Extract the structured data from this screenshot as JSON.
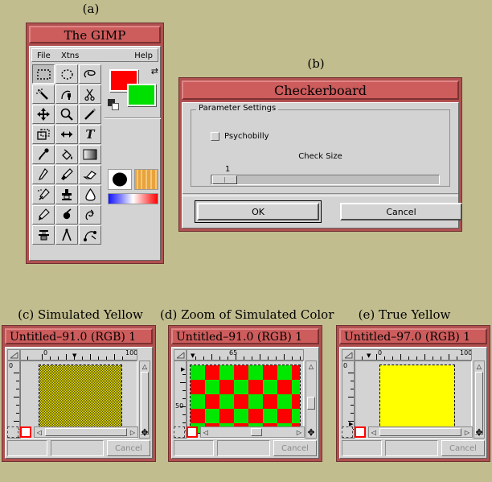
{
  "figure": {
    "labels": {
      "a": "(a)",
      "b": "(b)",
      "c": "(c) Simulated Yellow",
      "d": "(d) Zoom of Simulated Color",
      "e": "(e) True Yellow"
    },
    "background_color": "#c2bd8f"
  },
  "colors": {
    "titlebar": "#cd5c5c",
    "window_frame": "#b05050",
    "panel": "#d3d3d3",
    "foreground_swatch": "#ff0000",
    "background_swatch": "#00e000",
    "checker_red": "#ff0000",
    "checker_green": "#00e800",
    "true_yellow": "#ffff00",
    "simulated_yellow": "#8a8a10",
    "quickmask_active": "#ff0000"
  },
  "toolbox": {
    "title": "The GIMP",
    "menu": [
      {
        "label": "File"
      },
      {
        "label": "Xtns"
      },
      {
        "label": "Help"
      }
    ],
    "tools": [
      {
        "name": "rect-select-tool",
        "glyph": "rect-select",
        "active": true
      },
      {
        "name": "ellipse-select-tool",
        "glyph": "ellipse-select",
        "active": false
      },
      {
        "name": "free-select-tool",
        "glyph": "lasso",
        "active": false
      },
      {
        "name": "fuzzy-select-tool",
        "glyph": "magic-wand",
        "active": false
      },
      {
        "name": "bezier-select-tool",
        "glyph": "bezier-pen",
        "active": false
      },
      {
        "name": "intelligent-scissors-tool",
        "glyph": "scissors",
        "active": false
      },
      {
        "name": "move-tool",
        "glyph": "move-arrows",
        "active": false
      },
      {
        "name": "magnify-tool",
        "glyph": "magnifier",
        "active": false
      },
      {
        "name": "measure-tool",
        "glyph": "ruler-line",
        "active": false
      },
      {
        "name": "crop-tool",
        "glyph": "crop",
        "active": false
      },
      {
        "name": "transform-tool",
        "glyph": "flip-arrows",
        "active": false
      },
      {
        "name": "text-tool",
        "glyph": "letter-T",
        "active": false
      },
      {
        "name": "color-picker-tool",
        "glyph": "eyedropper",
        "active": false
      },
      {
        "name": "bucket-fill-tool",
        "glyph": "paint-bucket",
        "active": false
      },
      {
        "name": "blend-tool",
        "glyph": "gradient",
        "active": false
      },
      {
        "name": "pencil-tool",
        "glyph": "pencil",
        "active": false
      },
      {
        "name": "paintbrush-tool",
        "glyph": "paintbrush",
        "active": false
      },
      {
        "name": "eraser-tool",
        "glyph": "eraser",
        "active": false
      },
      {
        "name": "airbrush-tool",
        "glyph": "airbrush",
        "active": false
      },
      {
        "name": "clone-tool",
        "glyph": "stamp",
        "active": false
      },
      {
        "name": "convolve-tool",
        "glyph": "water-drop",
        "active": false
      },
      {
        "name": "ink-tool",
        "glyph": "ink-pen",
        "active": false
      },
      {
        "name": "dodge-burn-tool",
        "glyph": "dodge-burn",
        "active": false
      },
      {
        "name": "smudge-tool",
        "glyph": "smudge-hand",
        "active": false
      },
      {
        "name": "script-fu-tool",
        "glyph": "script-fu",
        "active": false
      },
      {
        "name": "path-tool",
        "glyph": "compass",
        "active": false
      },
      {
        "name": "curve-tool",
        "glyph": "curve-nodes",
        "active": false
      }
    ],
    "indicators": {
      "swap_icon": "⇄",
      "brush": "brush-indicator",
      "pattern": "pattern-indicator",
      "gradient": "gradient-indicator"
    }
  },
  "checkerboard_dialog": {
    "title": "Checkerboard",
    "frame_legend": "Parameter Settings",
    "psychobilly": {
      "label": "Psychobilly",
      "checked": false
    },
    "check_size": {
      "label": "Check Size",
      "value": "1"
    },
    "buttons": {
      "ok": "OK",
      "cancel": "Cancel"
    }
  },
  "image_windows": [
    {
      "key": "c",
      "title": "Untitled–91.0 (RGB) 1",
      "ruler_left": "0",
      "ruler_right": "100",
      "vruler_label": "0",
      "status_cancel": "Cancel",
      "fill": "simulated-yellow-checker"
    },
    {
      "key": "d",
      "title": "Untitled–91.0 (RGB) 1",
      "ruler_left": "65",
      "ruler_right": "",
      "vruler_label": "50",
      "status_cancel": "Cancel",
      "fill": "red-green-checker"
    },
    {
      "key": "e",
      "title": "Untitled–97.0 (RGB) 1",
      "ruler_left": "0",
      "ruler_right": "100",
      "vruler_label": "0",
      "status_cancel": "Cancel",
      "fill": "true-yellow"
    }
  ]
}
